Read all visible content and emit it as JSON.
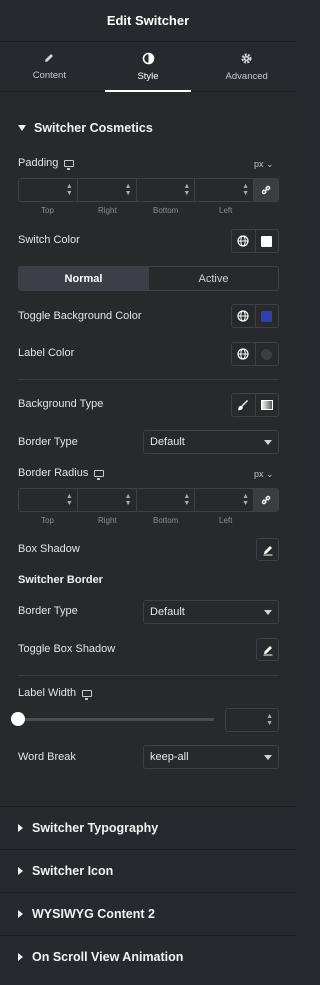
{
  "header": {
    "title": "Edit Switcher"
  },
  "tabs": [
    {
      "label": "Content",
      "icon": "pencil-icon"
    },
    {
      "label": "Style",
      "icon": "contrast-icon"
    },
    {
      "label": "Advanced",
      "icon": "gear-icon"
    }
  ],
  "cosmetics": {
    "title": "Switcher Cosmetics",
    "padding": {
      "label": "Padding",
      "unit": "px",
      "fields": [
        "Top",
        "Right",
        "Bottom",
        "Left"
      ]
    },
    "switch_color": {
      "label": "Switch Color",
      "swatch": "#ffffff"
    },
    "state_toggle": {
      "normal": "Normal",
      "active": "Active"
    },
    "toggle_bg": {
      "label": "Toggle Background Color",
      "swatch": "#2f3fb8"
    },
    "label_color": {
      "label": "Label Color"
    },
    "background_type": {
      "label": "Background Type"
    },
    "border_type": {
      "label": "Border Type",
      "value": "Default"
    },
    "border_radius": {
      "label": "Border Radius",
      "unit": "px",
      "fields": [
        "Top",
        "Right",
        "Bottom",
        "Left"
      ]
    },
    "box_shadow": {
      "label": "Box Shadow"
    },
    "switcher_border": {
      "title": "Switcher Border"
    },
    "border_type2": {
      "label": "Border Type",
      "value": "Default"
    },
    "toggle_box_shadow": {
      "label": "Toggle Box Shadow"
    },
    "label_width": {
      "label": "Label Width",
      "slider_fraction": 0
    },
    "word_break": {
      "label": "Word Break",
      "value": "keep-all"
    }
  },
  "sections": [
    {
      "title": "Switcher Typography"
    },
    {
      "title": "Switcher Icon"
    },
    {
      "title": "WYSIWYG Content 2"
    },
    {
      "title": "On Scroll View Animation"
    }
  ]
}
